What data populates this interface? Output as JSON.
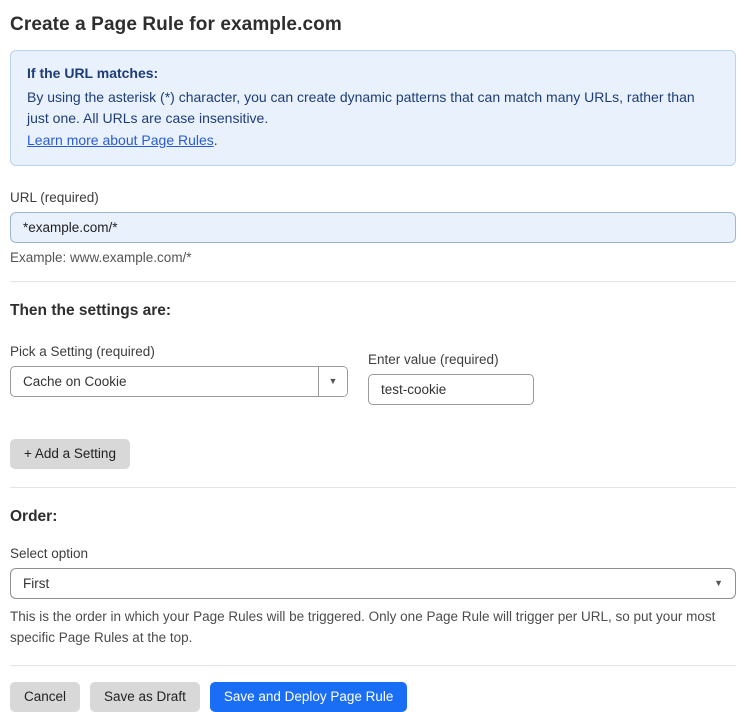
{
  "page": {
    "title": "Create a Page Rule for example.com"
  },
  "info_box": {
    "heading": "If the URL matches:",
    "body": "By using the asterisk (*) character, you can create dynamic patterns that can match many URLs, rather than just one. All URLs are case insensitive.",
    "link_label": "Learn more about Page Rules",
    "link_suffix": "."
  },
  "url_field": {
    "label": "URL (required)",
    "value": "*example.com/*",
    "example": "Example: www.example.com/*"
  },
  "settings": {
    "heading": "Then the settings are:",
    "setting_label": "Pick a Setting (required)",
    "setting_value": "Cache on Cookie",
    "value_label": "Enter value (required)",
    "value_value": "test-cookie",
    "add_button_label": "+ Add a Setting"
  },
  "order": {
    "heading": "Order:",
    "select_label": "Select option",
    "selected_option": "First",
    "help": "This is the order in which your Page Rules will be triggered. Only one Page Rule will trigger per URL, so put your most specific Page Rules at the top."
  },
  "footer": {
    "cancel_label": "Cancel",
    "save_draft_label": "Save as Draft",
    "save_deploy_label": "Save and Deploy Page Rule"
  },
  "icons": {
    "dropdown_arrow": "▼",
    "select_chevron": "▼"
  },
  "colors": {
    "accent_blue": "#1a6ef5",
    "info_bg": "#e9f2fc",
    "info_border": "#b7d3ef",
    "info_text": "#1e3c78",
    "link_blue": "#2a5bd7",
    "url_input_bg": "#e9f1fc",
    "button_gray": "#d8d8d8"
  }
}
